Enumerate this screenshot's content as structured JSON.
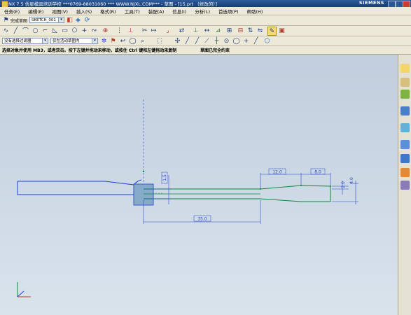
{
  "window": {
    "title": "NX 7.5 优星模具培训学校 ***0769-88031060 *** WWW.NJXL.COM*** - 草图 - [15.prt （修改的）]",
    "brand": "SIEMENS"
  },
  "menubar": {
    "items": [
      "任务(E)",
      "编辑(E)",
      "视图(V)",
      "插入(S)",
      "格式(R)",
      "工具(T)",
      "装配(A)",
      "信息(I)",
      "分析(L)",
      "首选项(P)",
      "帮助(H)"
    ]
  },
  "toolbar1": {
    "finish_label": "完成草图",
    "sketch_name": "SKETCH_001",
    "icons": [
      "finish-sketch-icon",
      "sketch-name-icon",
      "orient-view-icon",
      "reattach-icon",
      "update-model-icon"
    ]
  },
  "toolbar2": {
    "icons": [
      "profile-icon",
      "line-icon",
      "arc-icon",
      "circle-icon",
      "fillet-icon",
      "chamfer-icon",
      "rectangle-icon",
      "polygon-icon",
      "point-icon",
      "studio-spline-icon",
      "offset-curve-icon",
      "pattern-icon",
      "mirror-icon",
      "trim-icon",
      "extend-icon",
      "corner-icon",
      "move-curve-icon",
      "constraint-icon",
      "dimension-icon",
      "inferred-icon",
      "auto-constrain-icon",
      "show-constraints-icon",
      "convert-ref-icon",
      "alt-solution-icon",
      "sketch-style-icon",
      "sketch-layer-icon"
    ]
  },
  "toolbar3": {
    "filter": "没有选择过滤器",
    "scope": "仅在活动草图内",
    "snap_icons": [
      "snap-end-icon",
      "snap-mid-icon",
      "snap-control-icon",
      "snap-intersect-icon",
      "snap-center-icon",
      "snap-quadrant-icon",
      "snap-existing-icon",
      "snap-on-curve-icon",
      "snap-point-icon",
      "snap-bounding-icon"
    ]
  },
  "status": {
    "prompt": "选择对象并使用 MB3，或者双击。按下左键并拖动来移动，或按住 Ctrl 键和左键拖动来复制",
    "sketch_state": "草图已完全约束"
  },
  "drawing": {
    "dimensions": [
      "12.0",
      "8.0",
      "2.0",
      "4.0",
      "1.5",
      "35.0"
    ],
    "colors": {
      "profile": "#0b8a3a",
      "existing": "#1e3fd6",
      "dimension": "#2a48c6",
      "datum": "#6a6fd0",
      "canvas": "#c9d7e3"
    }
  },
  "rightbar": {
    "icons": [
      "assembly-navigator-icon",
      "constraint-navigator-icon",
      "part-navigator-icon",
      "reuse-library-icon",
      "history-icon",
      "process-studio-icon",
      "system-materials-icon",
      "roles-icon",
      "web-browser-icon"
    ]
  }
}
